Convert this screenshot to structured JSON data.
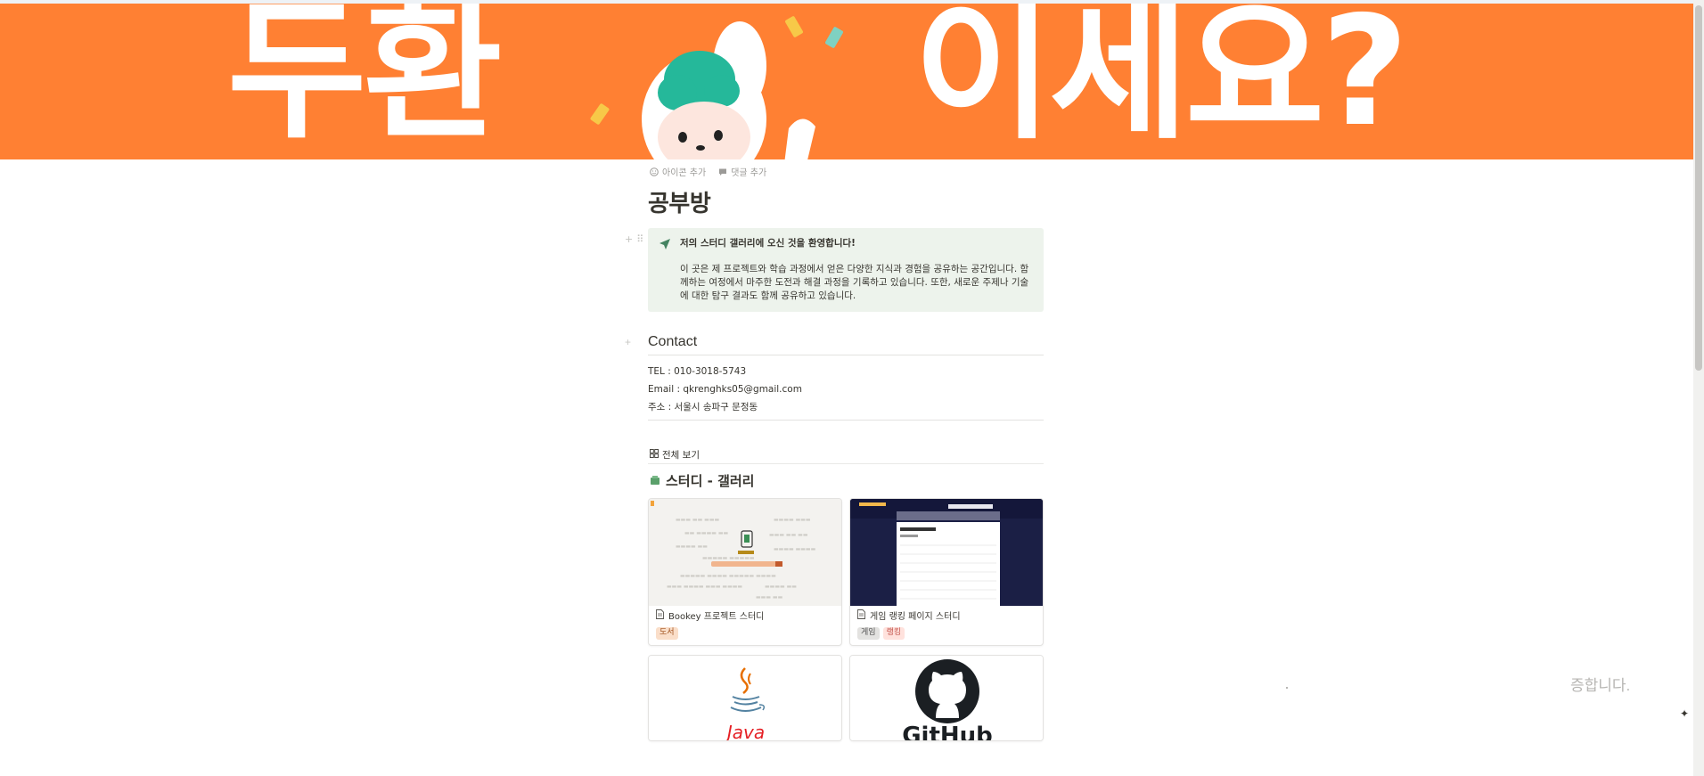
{
  "cover": {
    "left_text": "두환",
    "right_text": "이세요?",
    "color": "#ff8033"
  },
  "page": {
    "meta_actions": [
      {
        "icon": "smile-icon",
        "label": "아이콘 추가"
      },
      {
        "icon": "comment-icon",
        "label": "댓글 추가"
      }
    ],
    "title": "공부방",
    "callout": {
      "icon": "navigation-arrow-icon",
      "title": "저의 스터디 갤러리에 오신 것을 환영합니다!",
      "body": "이 곳은 제 프로젝트와 학습 과정에서 얻은 다양한 지식과 경험을 공유하는 공간입니다. 함께하는 여정에서 마주한 도전과 해결 과정을 기록하고 있습니다. 또한, 새로운 주제나 기술에 대한 탐구 결과도 함께 공유하고 있습니다."
    },
    "contact": {
      "heading": "Contact",
      "tel": "TEL : 010-3018-5743",
      "email": "Email : qkrenghks05@gmail.com",
      "address": "주소 : 서울시 송파구 문정동"
    },
    "gallery": {
      "view_tab": "전체 보기",
      "title": "스터디 - 갤러리",
      "cards": [
        {
          "title": "Bookey 프로젝트 스터디",
          "tags": [
            {
              "label": "도서",
              "color": "#fadec9",
              "text": "#a0521d"
            }
          ]
        },
        {
          "title": "게임 랭킹 페이지 스터디",
          "tags": [
            {
              "label": "게임",
              "color": "#e3e2e0",
              "text": "#555"
            },
            {
              "label": "랭킹",
              "color": "#ffe2dd",
              "text": "#c4554d"
            }
          ]
        },
        {
          "title": "Java",
          "tags": []
        },
        {
          "title": "GitHub",
          "tags": []
        }
      ]
    }
  },
  "floating_text": "증합니다."
}
